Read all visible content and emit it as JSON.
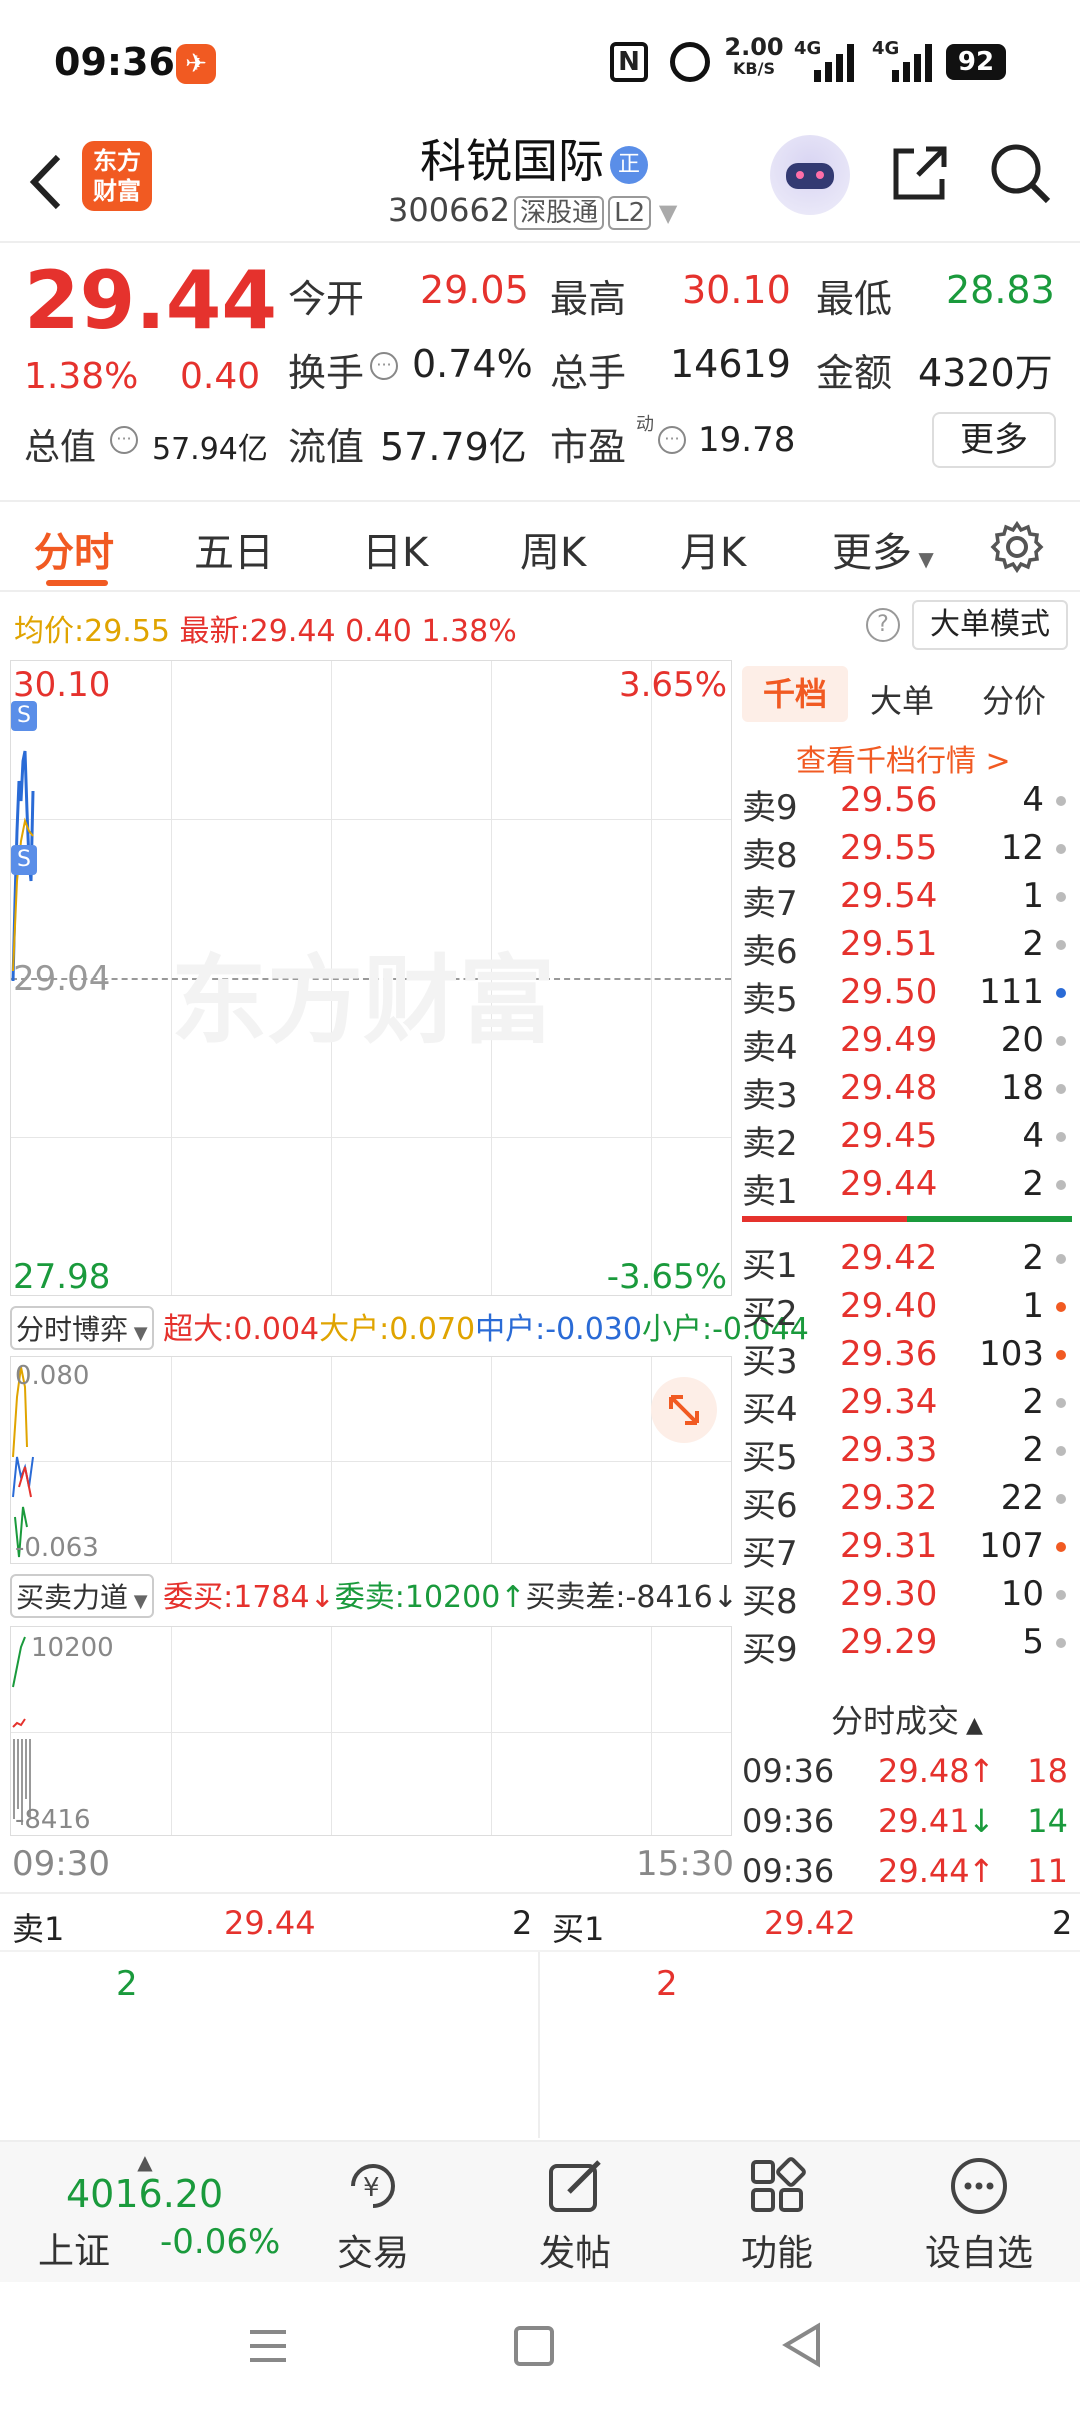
{
  "status": {
    "time": "09:36",
    "net_speed": "2.00",
    "net_unit": "KB/S",
    "net_type1": "4G",
    "net_type2": "4G",
    "battery": "92"
  },
  "header": {
    "back_icon": "back-arrow-icon",
    "logo_line1": "东方",
    "logo_line2": "财富",
    "title": "科锐国际",
    "title_badge": "正",
    "code": "300662",
    "tag1": "深股通",
    "tag2": "L2"
  },
  "quote": {
    "price": "29.44",
    "change_pct": "1.38%",
    "change": "0.40",
    "open_label": "今开",
    "open": "29.05",
    "high_label": "最高",
    "high": "30.10",
    "low_label": "最低",
    "low": "28.83",
    "turnover_label": "换手",
    "turnover": "0.74%",
    "volume_label": "总手",
    "volume": "14619",
    "amount_label": "金额",
    "amount": "4320万",
    "mktcap_label": "总值",
    "mktcap": "57.94亿",
    "float_label": "流值",
    "float": "57.79亿",
    "pe_label": "市盈",
    "pe_sup": "动",
    "pe": "19.78",
    "more_btn": "更多"
  },
  "tabs": [
    "分时",
    "五日",
    "日K",
    "周K",
    "月K",
    "更多"
  ],
  "info": {
    "avg_label": "均价:",
    "avg": "29.55",
    "latest_label": "最新:",
    "latest": "29.44",
    "chg": "0.40",
    "pct": "1.38%",
    "bigorder_btn": "大单模式"
  },
  "chart": {
    "high": "30.10",
    "high_pct": "3.65%",
    "mid": "29.04",
    "low": "27.98",
    "low_pct": "-3.65%",
    "watermark": "东方财富",
    "s_marker": "S",
    "time_start": "09:30",
    "time_end": "15:30"
  },
  "ind1": {
    "name": "分时博弈",
    "super": "超大:0.004",
    "big": "大户:0.070",
    "mid": "中户:-0.030",
    "small": "小户:-0.044",
    "top": "0.080",
    "bottom": "-0.063"
  },
  "ind2": {
    "name": "买卖力道",
    "buy": "委买:1784",
    "sell": "委卖:10200",
    "diff": "买卖差:-8416",
    "top": "10200",
    "bottom": "-8416"
  },
  "ob_tabs": [
    "千档",
    "大单",
    "分价"
  ],
  "ob_link": "查看千档行情 >",
  "asks": [
    {
      "l": "卖9",
      "p": "29.56",
      "v": "4"
    },
    {
      "l": "卖8",
      "p": "29.55",
      "v": "12"
    },
    {
      "l": "卖7",
      "p": "29.54",
      "v": "1"
    },
    {
      "l": "卖6",
      "p": "29.51",
      "v": "2"
    },
    {
      "l": "卖5",
      "p": "29.50",
      "v": "111"
    },
    {
      "l": "卖4",
      "p": "29.49",
      "v": "20"
    },
    {
      "l": "卖3",
      "p": "29.48",
      "v": "18"
    },
    {
      "l": "卖2",
      "p": "29.45",
      "v": "4"
    },
    {
      "l": "卖1",
      "p": "29.44",
      "v": "2"
    }
  ],
  "bids": [
    {
      "l": "买1",
      "p": "29.42",
      "v": "2"
    },
    {
      "l": "买2",
      "p": "29.40",
      "v": "1"
    },
    {
      "l": "买3",
      "p": "29.36",
      "v": "103"
    },
    {
      "l": "买4",
      "p": "29.34",
      "v": "2"
    },
    {
      "l": "买5",
      "p": "29.33",
      "v": "2"
    },
    {
      "l": "买6",
      "p": "29.32",
      "v": "22"
    },
    {
      "l": "买7",
      "p": "29.31",
      "v": "107"
    },
    {
      "l": "买8",
      "p": "29.30",
      "v": "10"
    },
    {
      "l": "买9",
      "p": "29.29",
      "v": "5"
    }
  ],
  "trades_header": "分时成交",
  "trades": [
    {
      "t": "09:36",
      "p": "29.48",
      "d": "↑",
      "v": "18"
    },
    {
      "t": "09:36",
      "p": "29.41",
      "d": "↓",
      "v": "14"
    },
    {
      "t": "09:36",
      "p": "29.44",
      "d": "↑",
      "v": "11"
    }
  ],
  "level1": {
    "ask_label": "卖1",
    "ask_price": "29.44",
    "ask_vol": "2",
    "bid_label": "买1",
    "bid_price": "29.42",
    "bid_vol": "2",
    "ask_queue": "2",
    "bid_queue": "2"
  },
  "bottom": {
    "index_value": "4016.20",
    "index_name": "上证",
    "index_pct": "-0.06%",
    "trade": "交易",
    "post": "发帖",
    "func": "功能",
    "watch": "设自选"
  }
}
